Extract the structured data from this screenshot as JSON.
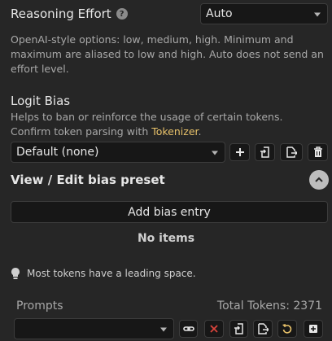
{
  "reasoning": {
    "title": "Reasoning Effort",
    "help_glyph": "?",
    "selected": "Auto",
    "description": "OpenAI-style options: low, medium, high. Minimum and maximum are aliased to low and high. Auto does not send an effort level."
  },
  "logit_bias": {
    "title": "Logit Bias",
    "description_before_link": "Helps to ban or reinforce the usage of certain tokens. Confirm token parsing with ",
    "link_text": "Tokenizer",
    "description_after_link": ".",
    "preset_selected": "Default (none)",
    "toolbar_icons": [
      "plus-icon",
      "import-icon",
      "export-icon",
      "trash-icon"
    ]
  },
  "bias_preset": {
    "title": "View / Edit bias preset",
    "add_label": "Add bias entry",
    "empty_text": "No items",
    "tip": "Most tokens have a leading space."
  },
  "prompts": {
    "label": "Prompts",
    "total_tokens": "Total Tokens: 2371",
    "selected": "",
    "toolbar_icons": [
      "link-icon",
      "delete-icon",
      "import-icon",
      "export-icon",
      "reset-icon",
      "add-icon"
    ]
  },
  "colors": {
    "background": "#262626",
    "control_bg": "#171717",
    "border": "#3c3c3c",
    "link": "#e8c26a",
    "danger": "#d9443c",
    "reset": "#e8c26a"
  }
}
